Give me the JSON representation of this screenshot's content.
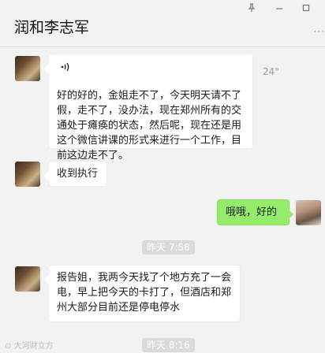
{
  "window": {
    "title": "润和李志军",
    "pin_icon": "pin-icon",
    "minimize_icon": "minimize-icon",
    "maximize_icon": "maximize-icon",
    "more_glyph": "···"
  },
  "messages": [
    {
      "side": "left",
      "type": "voice-transcript",
      "voice_icon": "voice-icon",
      "duration": "24\"",
      "text": "好的好的，金姐走不了，今天明天请不了假，走不了，没办法，现在郑州所有的交通处于瘫痪的状态，然后呢，现在还是用这个微信讲课的形式来进行一个工作，目前这边走不了。"
    },
    {
      "side": "left",
      "type": "text",
      "text": "收到执行"
    },
    {
      "side": "right",
      "type": "text",
      "text": "哦哦，好的"
    },
    {
      "type": "time",
      "text": "昨天 7:58"
    },
    {
      "side": "left",
      "type": "text",
      "text": "报告姐，我两今天找了个地方充了一会电，早上把今天的卡打了，但酒店和郑州大部分目前还是停电停水"
    },
    {
      "type": "time",
      "text": "昨天 8:16"
    }
  ],
  "watermark": "大河财立方",
  "colors": {
    "background": "#f2f2f2",
    "sent_bubble": "#95ec69",
    "received_bubble": "#ffffff"
  }
}
